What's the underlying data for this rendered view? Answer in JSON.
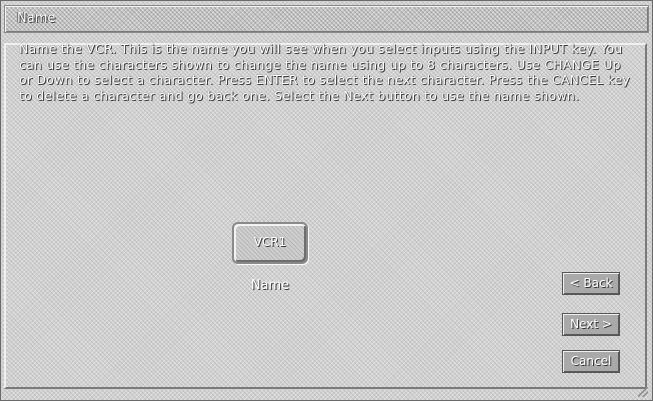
{
  "dialog": {
    "title": "Name",
    "instructions": "Name the VCR. This is the name you will see when you select inputs using the INPUT key. You can use the characters shown to change the name using up to 8 characters. Use CHANGE Up or Down to select a character. Press ENTER to select the next character. Press the CANCEL key to delete a character and go back one. Select the Next button to use the name shown."
  },
  "name_field": {
    "value": "VCR1",
    "label": "Name"
  },
  "buttons": {
    "back": "< Back",
    "next": "Next >",
    "cancel": "Cancel"
  }
}
